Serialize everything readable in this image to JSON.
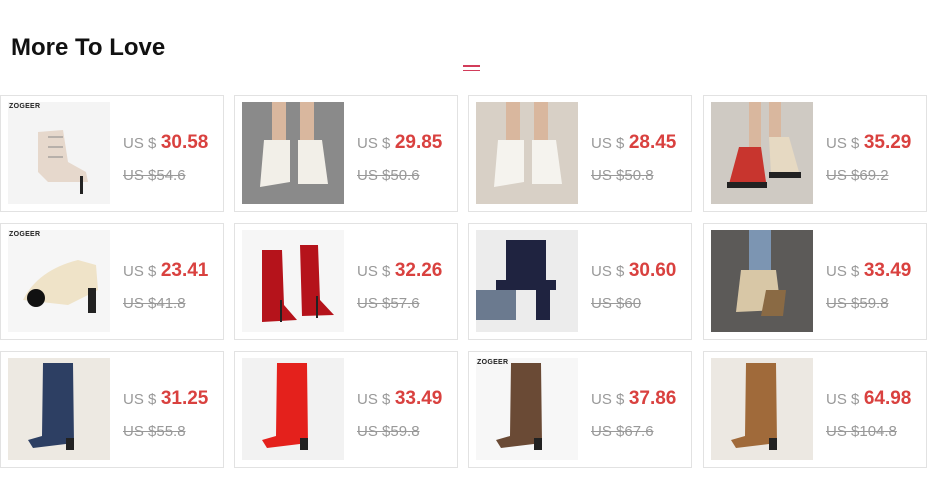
{
  "section": {
    "title": "More To Love"
  },
  "currency_prefix": "US $",
  "products": [
    {
      "brand": "ZOGEER",
      "price": "30.58",
      "original": "US $54.6",
      "thumb": {
        "bg": "#f4f4f4",
        "shoe": "#e6d8cc",
        "style": "bootie"
      }
    },
    {
      "brand": "",
      "price": "29.85",
      "original": "US $50.6",
      "thumb": {
        "bg": "#8a8a8a",
        "shoe": "#f2efe8",
        "style": "ankle"
      }
    },
    {
      "brand": "",
      "price": "28.45",
      "original": "US $50.8",
      "thumb": {
        "bg": "#d8d0c6",
        "shoe": "#f5f3ee",
        "style": "ankle"
      }
    },
    {
      "brand": "",
      "price": "35.29",
      "original": "US $69.2",
      "thumb": {
        "bg": "#cfcac3",
        "shoe": "#c8352e",
        "style": "combat"
      }
    },
    {
      "brand": "ZOGEER",
      "price": "23.41",
      "original": "US $41.8",
      "thumb": {
        "bg": "#f6f6f6",
        "shoe": "#efe3c8",
        "style": "pump"
      }
    },
    {
      "brand": "",
      "price": "32.26",
      "original": "US $57.6",
      "thumb": {
        "bg": "#f6f6f6",
        "shoe": "#b5131b",
        "style": "stiletto"
      }
    },
    {
      "brand": "",
      "price": "30.60",
      "original": "US $60",
      "thumb": {
        "bg": "#ececec",
        "shoe": "#1f2340",
        "style": "platform"
      }
    },
    {
      "brand": "",
      "price": "33.49",
      "original": "US $59.8",
      "thumb": {
        "bg": "#5c5a58",
        "shoe": "#d8c7a6",
        "style": "wedge"
      }
    },
    {
      "brand": "",
      "price": "31.25",
      "original": "US $55.8",
      "thumb": {
        "bg": "#ede9e2",
        "shoe": "#2d3f63",
        "style": "tall"
      }
    },
    {
      "brand": "",
      "price": "33.49",
      "original": "US $59.8",
      "thumb": {
        "bg": "#f2f2f2",
        "shoe": "#e4211c",
        "style": "tall"
      }
    },
    {
      "brand": "ZOGEER",
      "price": "37.86",
      "original": "US $67.6",
      "thumb": {
        "bg": "#f7f7f7",
        "shoe": "#6a4a35",
        "style": "tall"
      }
    },
    {
      "brand": "",
      "price": "64.98",
      "original": "US $104.8",
      "thumb": {
        "bg": "#ece8e2",
        "shoe": "#a06a3a",
        "style": "tall"
      }
    }
  ]
}
